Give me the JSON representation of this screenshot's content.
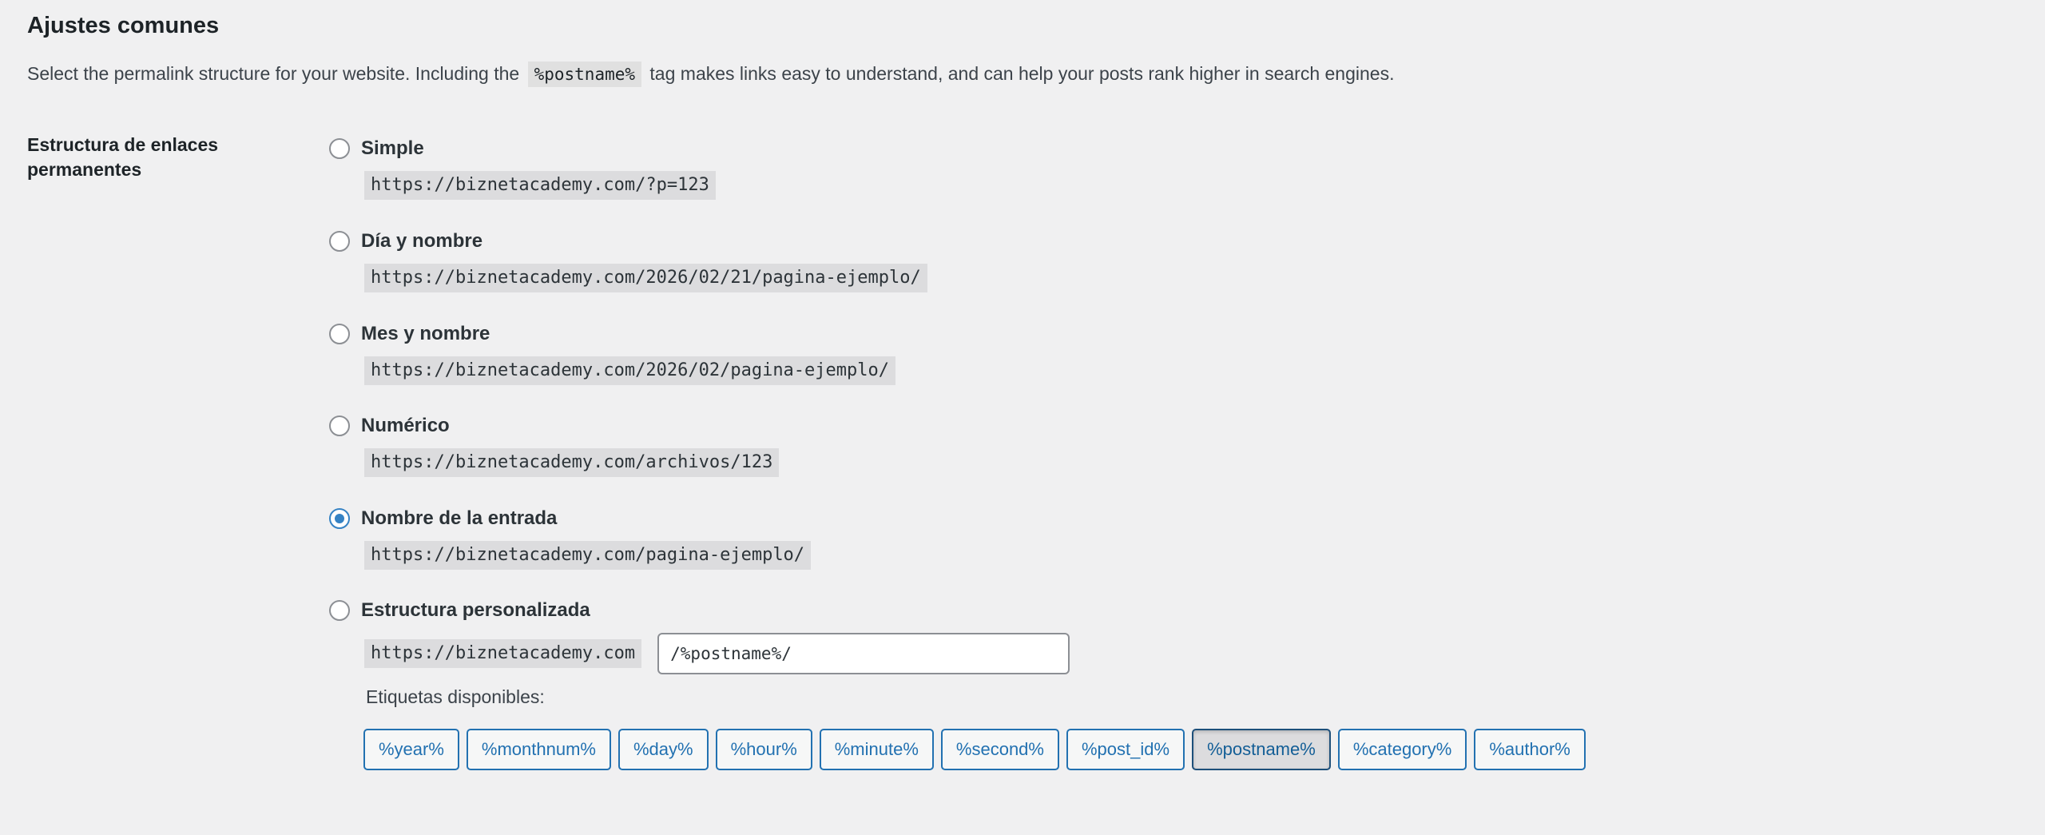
{
  "section": {
    "title": "Ajustes comunes",
    "description_before": "Select the permalink structure for your website. Including the",
    "description_code": "%postname%",
    "description_after": "tag makes links easy to understand, and can help your posts rank higher in search engines."
  },
  "field": {
    "label": "Estructura de enlaces permanentes"
  },
  "options": [
    {
      "label": "Simple",
      "example": "https://biznetacademy.com/?p=123",
      "checked": false
    },
    {
      "label": "Día y nombre",
      "example": "https://biznetacademy.com/2026/02/21/pagina-ejemplo/",
      "checked": false
    },
    {
      "label": "Mes y nombre",
      "example": "https://biznetacademy.com/2026/02/pagina-ejemplo/",
      "checked": false
    },
    {
      "label": "Numérico",
      "example": "https://biznetacademy.com/archivos/123",
      "checked": false
    },
    {
      "label": "Nombre de la entrada",
      "example": "https://biznetacademy.com/pagina-ejemplo/",
      "checked": true
    },
    {
      "label": "Estructura personalizada",
      "example": "https://biznetacademy.com",
      "checked": false
    }
  ],
  "custom": {
    "value": "/%postname%/"
  },
  "tags": {
    "label": "Etiquetas disponibles:",
    "items": [
      "%year%",
      "%monthnum%",
      "%day%",
      "%hour%",
      "%minute%",
      "%second%",
      "%post_id%",
      "%postname%",
      "%category%",
      "%author%"
    ],
    "active": "%postname%"
  },
  "colors": {
    "background": "#f0f0f1",
    "accent": "#2271b1",
    "radio_checked": "#3582c4"
  }
}
